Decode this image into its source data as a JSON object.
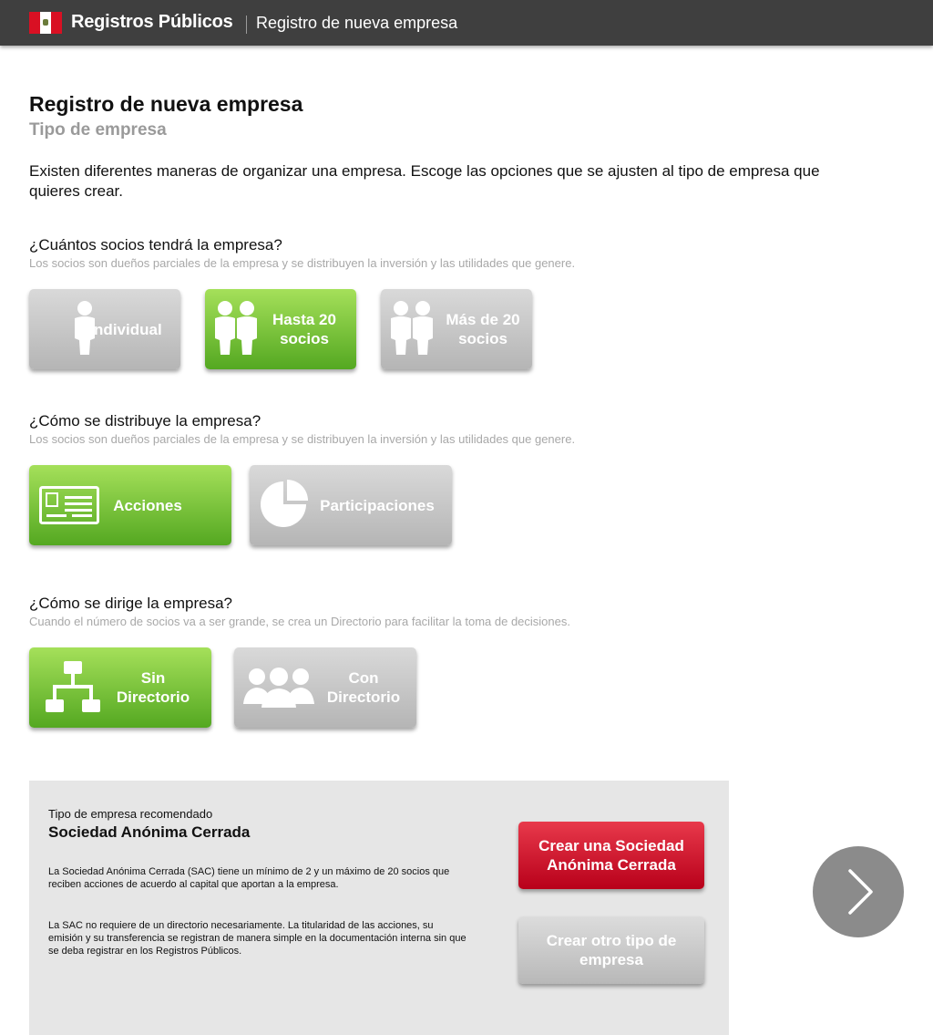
{
  "header": {
    "brand": "Registros Públicos",
    "section": "Registro de nueva empresa"
  },
  "page": {
    "title": "Registro de nueva empresa",
    "subtitle": "Tipo de empresa",
    "intro": "Existen diferentes maneras de organizar una empresa. Escoge las opciones que se ajusten al tipo de empresa que quieres crear."
  },
  "q1": {
    "question": "¿Cuántos socios tendrá la empresa?",
    "hint": "Los socios son dueños parciales de la empresa y se distribuyen la inversión y las utilidades que genere.",
    "options": [
      {
        "label": "Individual",
        "selected": false
      },
      {
        "label": "Hasta 20 socios",
        "selected": true
      },
      {
        "label": "Más de 20 socios",
        "selected": false
      }
    ]
  },
  "q2": {
    "question": "¿Cómo se distribuye la empresa?",
    "hint": "Los socios son dueños parciales de la empresa y se distribuyen la inversión y las utilidades que genere.",
    "options": [
      {
        "label": "Acciones",
        "selected": true
      },
      {
        "label": "Participaciones",
        "selected": false
      }
    ]
  },
  "q3": {
    "question": "¿Cómo se dirige la empresa?",
    "hint": "Cuando el número de socios va a ser grande, se crea un Directorio para facilitar la toma de decisiones.",
    "options": [
      {
        "label": "Sin Directorio",
        "selected": true
      },
      {
        "label": "Con Directorio",
        "selected": false
      }
    ]
  },
  "recommendation": {
    "label": "Tipo de empresa recomendado",
    "name": "Sociedad Anónima Cerrada",
    "paragraph1": "La Sociedad Anónima Cerrada (SAC) tiene un mínimo de 2 y un máximo de 20 socios que reciben acciones de acuerdo al capital que aportan a la empresa.",
    "paragraph2": "La SAC no requiere de un directorio necesariamente. La titularidad de las acciones, su emisión y su transferencia se registran de manera simple en la documentación interna sin que se deba registrar en los Registros Públicos.",
    "primary_button": "Crear una Sociedad Anónima Cerrada",
    "secondary_button": "Crear otro tipo de empresa"
  },
  "colors": {
    "topbar": "#3f3f3f",
    "selected": "#54a821",
    "unselected": "#b5b5b5",
    "primary": "#d0102a"
  },
  "icons": [
    "flag-peru-icon",
    "person-icon",
    "two-persons-icon",
    "certificate-icon",
    "pie-chart-icon",
    "org-chart-icon",
    "group-icon",
    "chevron-right-icon"
  ]
}
